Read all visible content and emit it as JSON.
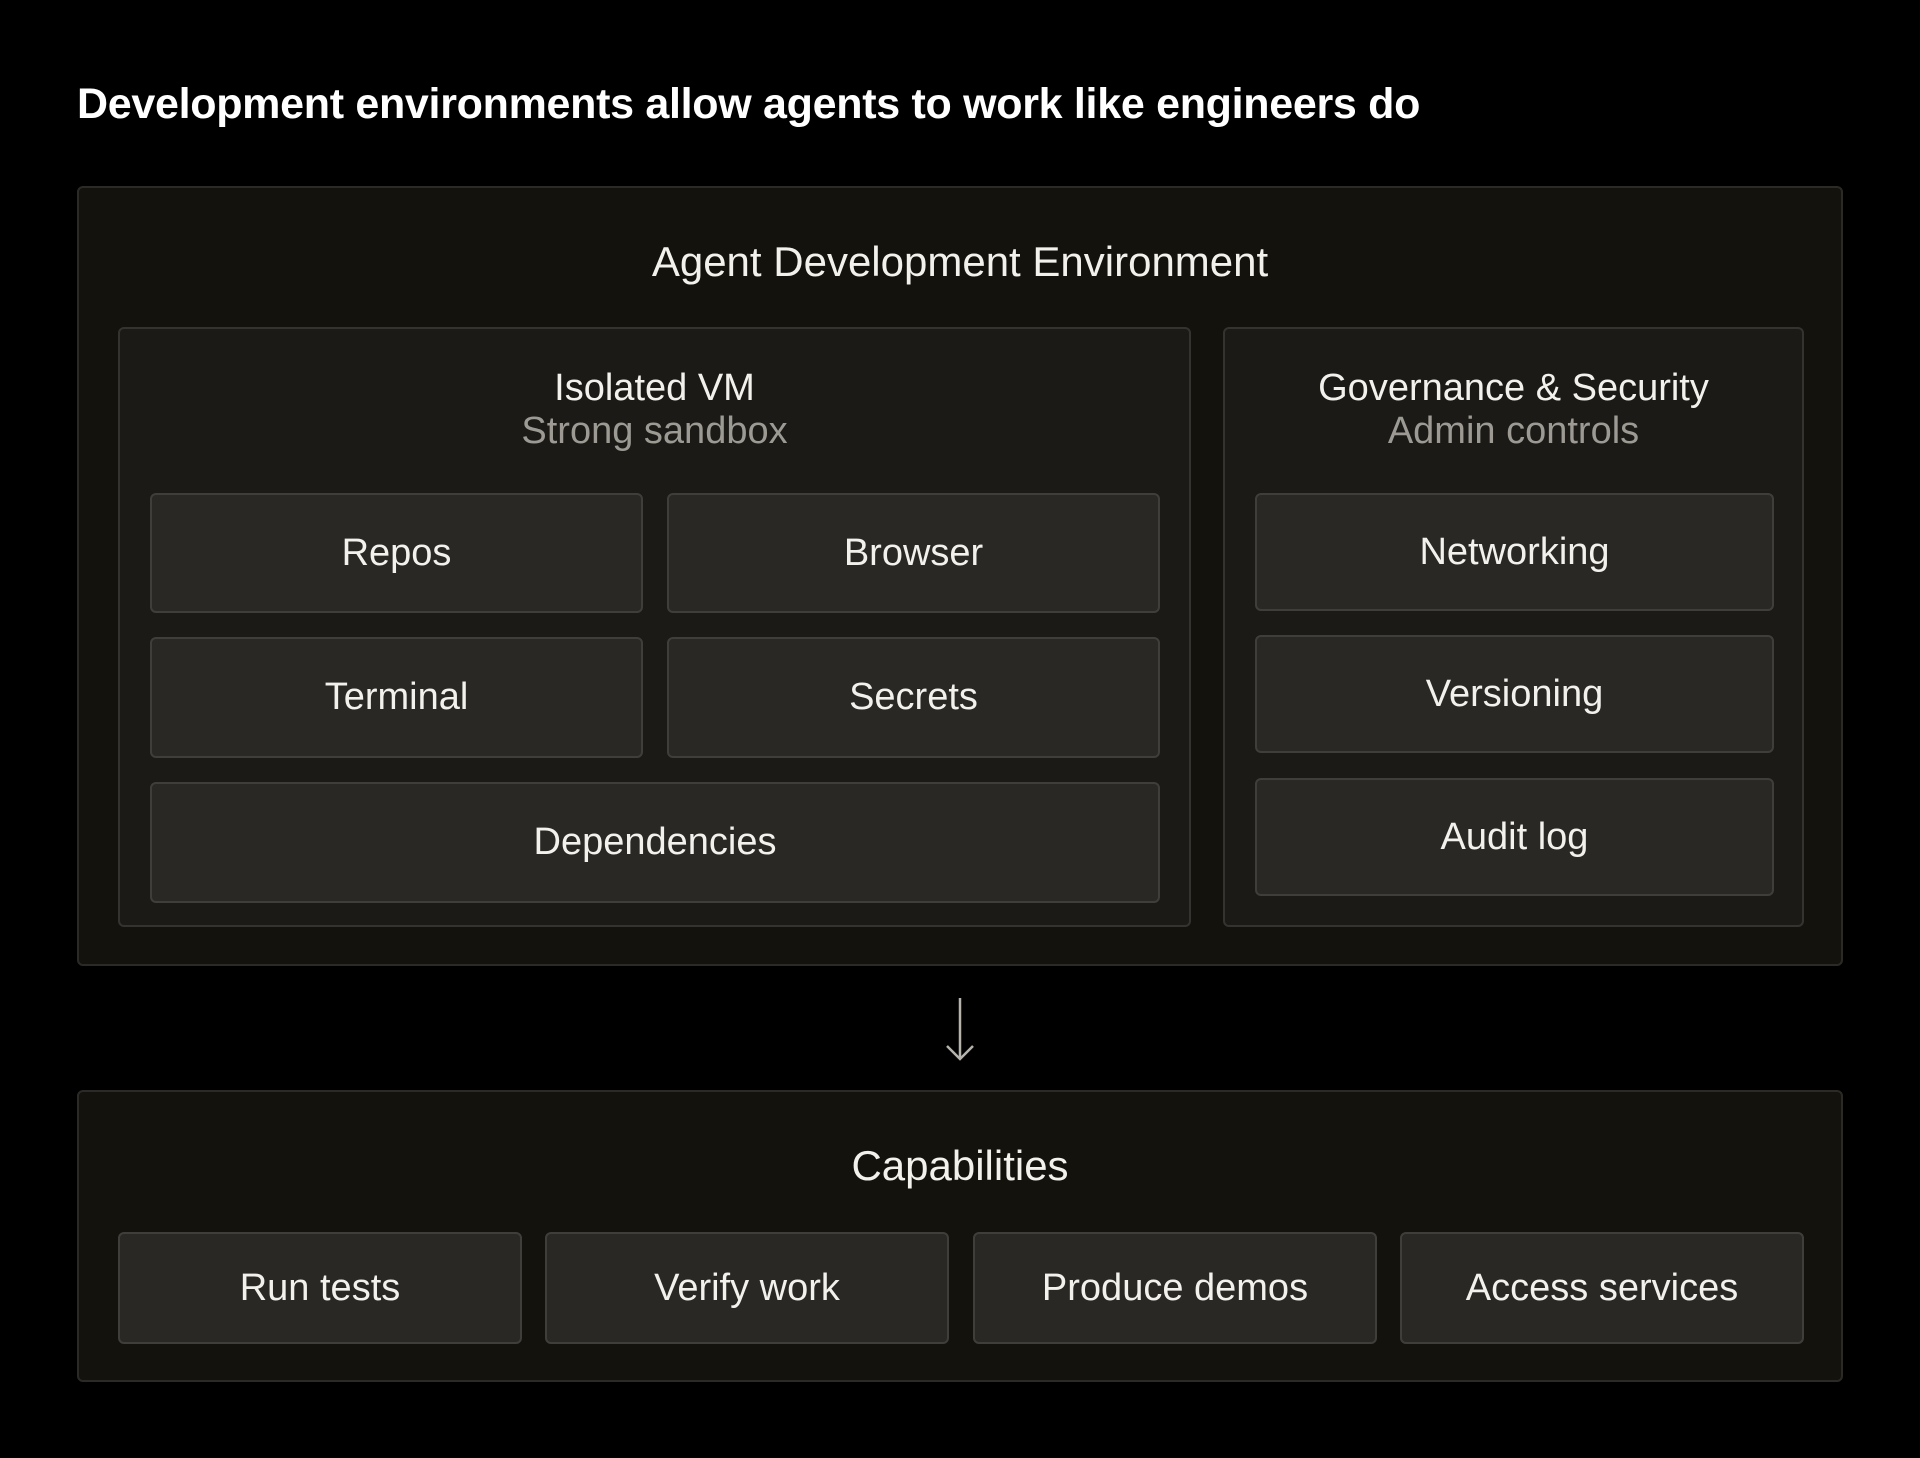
{
  "heading": "Development environments allow agents to work like engineers do",
  "environment": {
    "title": "Agent Development Environment",
    "isolated_vm": {
      "title": "Isolated VM",
      "subtitle": "Strong sandbox",
      "items": [
        "Repos",
        "Browser",
        "Terminal",
        "Secrets",
        "Dependencies"
      ]
    },
    "governance": {
      "title": "Governance & Security",
      "subtitle": "Admin controls",
      "items": [
        "Networking",
        "Versioning",
        "Audit log"
      ]
    }
  },
  "capabilities": {
    "title": "Capabilities",
    "items": [
      "Run tests",
      "Verify work",
      "Produce demos",
      "Access services"
    ]
  },
  "colors": {
    "background": "#000000",
    "panel": "#14120d",
    "group": "#1b1a17",
    "box": "#292825",
    "subtitle_text": "#9c9a93"
  }
}
